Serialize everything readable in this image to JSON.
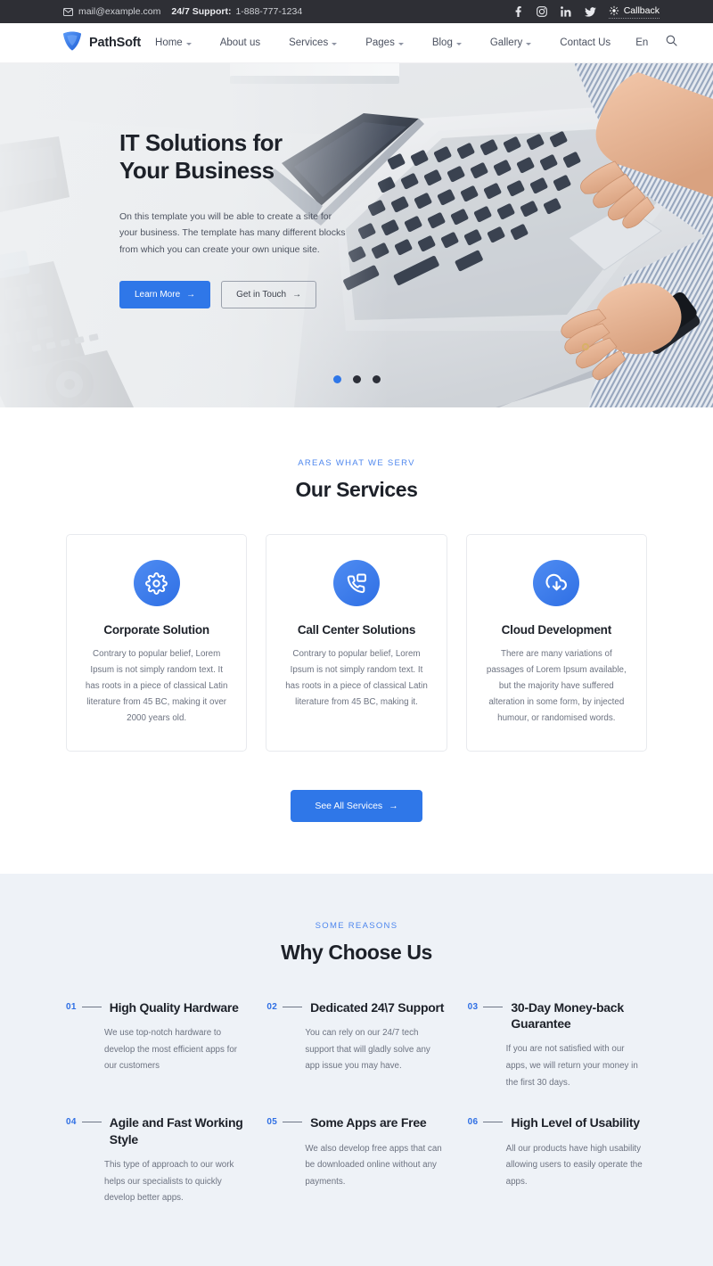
{
  "topbar": {
    "email": "mail@example.com",
    "support_label": "24/7 Support:",
    "support_phone": "1-888-777-1234",
    "mail_icon": "envelope-icon",
    "socials": [
      {
        "name": "facebook-icon",
        "glyph": "f"
      },
      {
        "name": "instagram-icon",
        "glyph": "□"
      },
      {
        "name": "linkedin-icon",
        "glyph": "in"
      },
      {
        "name": "twitter-icon",
        "glyph": "✈"
      }
    ],
    "callback_label": "Callback",
    "callback_icon": "phone-callback-icon"
  },
  "header": {
    "brand": "PathSoft",
    "logo_icon": "shield-logo-icon",
    "nav": [
      {
        "label": "Home",
        "caret": true
      },
      {
        "label": "About us",
        "caret": false
      },
      {
        "label": "Services",
        "caret": true
      },
      {
        "label": "Pages",
        "caret": true
      },
      {
        "label": "Blog",
        "caret": true
      },
      {
        "label": "Gallery",
        "caret": true
      },
      {
        "label": "Contact Us",
        "caret": false
      }
    ],
    "language": "En",
    "search_icon": "search-icon"
  },
  "hero": {
    "title_line1": "IT Solutions for",
    "title_line2": "Your Business",
    "paragraph": "On this template you will be able to create a site for your business. The template has many different blocks from which you can create your own unique site.",
    "primary_button": "Learn More",
    "secondary_button": "Get in Touch",
    "arrow": "→",
    "slides": [
      {
        "active": true
      },
      {
        "active": false
      },
      {
        "active": false
      }
    ]
  },
  "services": {
    "eyebrow": "AREAS WHAT WE SERV",
    "title": "Our Services",
    "cards": [
      {
        "icon": "gear-icon",
        "title": "Corporate Solution",
        "text": "Contrary to popular belief, Lorem Ipsum is not simply random text. It has roots in a piece of classical Latin literature from 45 BC, making it over 2000 years old."
      },
      {
        "icon": "call-center-icon",
        "title": "Call Center Solutions",
        "text": "Contrary to popular belief, Lorem Ipsum is not simply random text. It has roots in a piece of classical Latin literature from 45 BC, making it."
      },
      {
        "icon": "cloud-download-icon",
        "title": "Cloud Development",
        "text": "There are many variations of passages of Lorem Ipsum available, but the majority have suffered alteration in some form, by injected humour, or randomised words."
      }
    ],
    "cta_label": "See All Services"
  },
  "why": {
    "eyebrow": "SOME REASONS",
    "title": "Why Choose Us",
    "items": [
      {
        "number": "01",
        "title": "High Quality Hardware",
        "text": "We use top-notch hardware to develop the most efficient apps for our customers"
      },
      {
        "number": "02",
        "title": "Dedicated 24\\7 Support",
        "text": "You can rely on our 24/7 tech support that will gladly solve any app issue you may have."
      },
      {
        "number": "03",
        "title": "30-Day Money-back Guarantee",
        "text": "If you are not satisfied with our apps, we will return your money in the first 30 days."
      },
      {
        "number": "04",
        "title": "Agile and Fast Working Style",
        "text": "This type of approach to our work helps our specialists to quickly develop better apps."
      },
      {
        "number": "05",
        "title": "Some Apps are Free",
        "text": "We also develop free apps that can be downloaded online without any payments."
      },
      {
        "number": "06",
        "title": "High Level of Usability",
        "text": "All our products have high usability allowing users to easily operate the apps."
      }
    ]
  },
  "colors": {
    "accent": "#2f77e8",
    "accent_light": "#4e87ee",
    "dark": "#2e2f35",
    "heading": "#1d2129",
    "body_text": "#6d7381",
    "why_bg": "#eef2f7"
  }
}
